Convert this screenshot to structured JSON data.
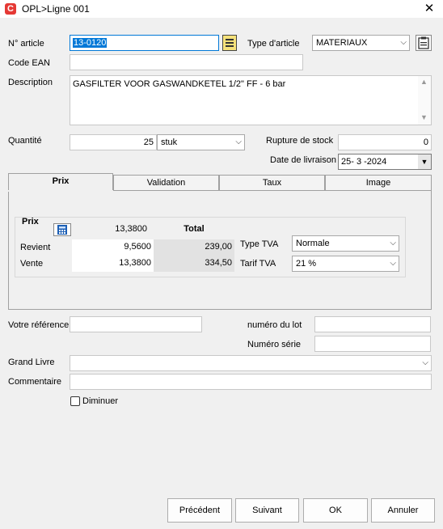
{
  "window": {
    "app_icon": "C",
    "title": "OPL>Ligne   001",
    "close_glyph": "✕"
  },
  "article": {
    "label": "N° article",
    "value": "13-0120"
  },
  "type_article": {
    "label": "Type d'article",
    "value": "MATERIAUX"
  },
  "ean": {
    "label": "Code EAN",
    "value": ""
  },
  "description": {
    "label": "Description",
    "value": "GASFILTER VOOR GASWANDKETEL 1/2\" FF - 6 bar"
  },
  "quantite": {
    "label": "Quantité",
    "value": "25",
    "unit": "stuk"
  },
  "rupture": {
    "label": "Rupture de stock",
    "value": "0"
  },
  "livraison": {
    "label": "Date de livraison",
    "value": "25- 3 -2024"
  },
  "tabs": [
    {
      "label": "Prix"
    },
    {
      "label": "Validation"
    },
    {
      "label": "Taux"
    },
    {
      "label": "Image"
    }
  ],
  "prix": {
    "group_label": "Prix",
    "header_value": "13,3800",
    "total_label": "Total",
    "revient_label": "Revient",
    "revient_value": "9,5600",
    "revient_total": "239,00",
    "vente_label": "Vente",
    "vente_value": "13,3800",
    "vente_total": "334,50",
    "type_tva_label": "Type TVA",
    "type_tva_value": "Normale",
    "tarif_tva_label": "Tarif TVA",
    "tarif_tva_value": "21 %"
  },
  "reference": {
    "label": "Votre référence",
    "value": ""
  },
  "lot": {
    "label": "numéro du lot",
    "value": ""
  },
  "serie": {
    "label": "Numéro série",
    "value": ""
  },
  "grand_livre": {
    "label": "Grand Livre",
    "value": ""
  },
  "commentaire": {
    "label": "Commentaire",
    "value": ""
  },
  "diminuer": {
    "label": "Diminuer",
    "checked": false
  },
  "buttons": {
    "precedent": "Précédent",
    "suivant": "Suivant",
    "ok": "OK",
    "annuler": "Annuler"
  }
}
